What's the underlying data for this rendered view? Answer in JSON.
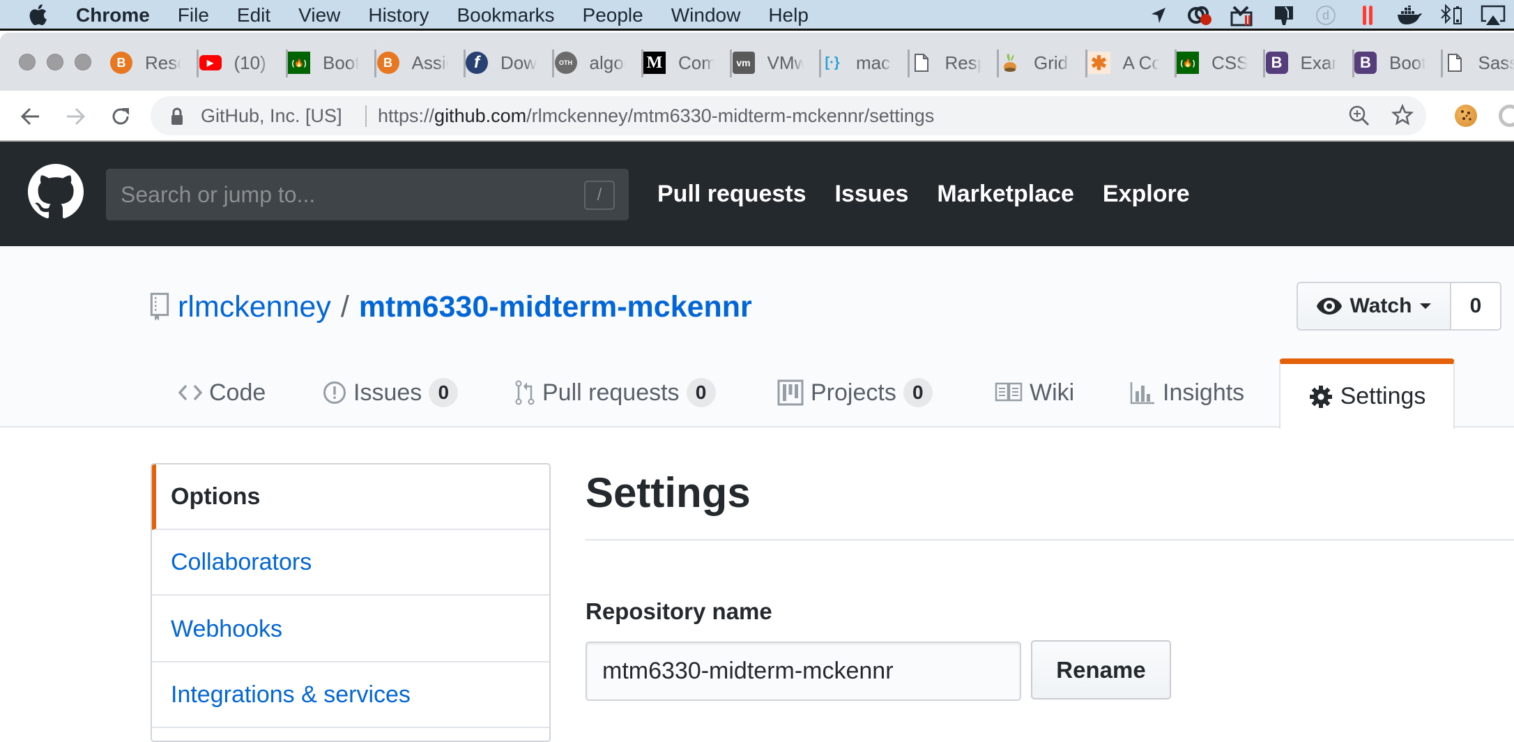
{
  "menubar": {
    "app": "Chrome",
    "items": [
      "File",
      "Edit",
      "View",
      "History",
      "Bookmarks",
      "People",
      "Window",
      "Help"
    ],
    "status_icons": [
      "location-arrow-icon",
      "creative-cloud-icon",
      "toolbox-icon",
      "monitor-icon",
      "d-circle-icon",
      "pause-bars-icon",
      "docker-icon",
      "bluetooth-battery-icon",
      "airplay-icon"
    ]
  },
  "tabs": [
    {
      "title": "Resources",
      "icon": "brightspace-icon",
      "color": "#e87722",
      "glyph": "B"
    },
    {
      "title": "(10)",
      "icon": "youtube-icon",
      "color": "#ff0000",
      "glyph": "▶"
    },
    {
      "title": "Bootstrap",
      "icon": "freecodecamp-icon",
      "color": "#006400",
      "glyph": "(🔥)"
    },
    {
      "title": "Assignments",
      "icon": "brightspace-icon",
      "color": "#e87722",
      "glyph": "B"
    },
    {
      "title": "Download",
      "icon": "fedora-icon",
      "color": "#294172",
      "glyph": "f"
    },
    {
      "title": "algorithm",
      "icon": "oth-icon",
      "color": "#6b6b6b",
      "glyph": "OTH"
    },
    {
      "title": "Com",
      "icon": "medium-icon",
      "color": "#000000",
      "glyph": "M"
    },
    {
      "title": "VMware",
      "icon": "vmware-icon",
      "color": "#5a5a5a",
      "glyph": "vm"
    },
    {
      "title": "mac",
      "icon": "brackets-icon",
      "color": "#ffffff",
      "glyph": "[·}"
    },
    {
      "title": "Responsive",
      "icon": "document-icon",
      "color": "#ffffff",
      "glyph": ""
    },
    {
      "title": "Grid",
      "icon": "carrot-icon",
      "color": "#dee1e6",
      "glyph": ""
    },
    {
      "title": "A Complete",
      "icon": "asterisk-icon",
      "color": "#fde9d9",
      "glyph": "✱"
    },
    {
      "title": "CSS",
      "icon": "freecodecamp-icon",
      "color": "#006400",
      "glyph": "(🔥)"
    },
    {
      "title": "Examples",
      "icon": "bootstrap-icon",
      "color": "#563d7c",
      "glyph": "B"
    },
    {
      "title": "Bootstrap",
      "icon": "bootstrap-icon",
      "color": "#563d7c",
      "glyph": "B"
    },
    {
      "title": "Sass",
      "icon": "document-icon",
      "color": "#ffffff",
      "glyph": ""
    }
  ],
  "toolbar": {
    "site_identity": "GitHub, Inc. [US]",
    "url_scheme": "https://",
    "url_host": "github.com",
    "url_path": "/rlmckenney/mtm6330-midterm-mckennr/settings"
  },
  "github": {
    "search_placeholder": "Search or jump to...",
    "search_shortcut": "/",
    "nav": [
      "Pull requests",
      "Issues",
      "Marketplace",
      "Explore"
    ],
    "owner": "rlmckenney",
    "separator": "/",
    "repo": "mtm6330-midterm-mckennr",
    "watch_label": "Watch",
    "watch_count": "0",
    "repo_tabs": [
      {
        "label": "Code",
        "icon": "code-icon",
        "count": null
      },
      {
        "label": "Issues",
        "icon": "issue-icon",
        "count": "0"
      },
      {
        "label": "Pull requests",
        "icon": "pull-request-icon",
        "count": "0"
      },
      {
        "label": "Projects",
        "icon": "project-icon",
        "count": "0"
      },
      {
        "label": "Wiki",
        "icon": "book-icon",
        "count": null
      },
      {
        "label": "Insights",
        "icon": "graph-icon",
        "count": null
      },
      {
        "label": "Settings",
        "icon": "gear-icon",
        "count": null,
        "selected": true
      }
    ],
    "accent_color": "#e36209",
    "link_color": "#0366d6"
  },
  "sidebar": {
    "items": [
      {
        "label": "Options",
        "selected": true
      },
      {
        "label": "Collaborators"
      },
      {
        "label": "Webhooks"
      },
      {
        "label": "Integrations & services"
      }
    ]
  },
  "main": {
    "title": "Settings",
    "repo_name_label": "Repository name",
    "repo_name_value": "mtm6330-midterm-mckennr",
    "rename_label": "Rename"
  }
}
